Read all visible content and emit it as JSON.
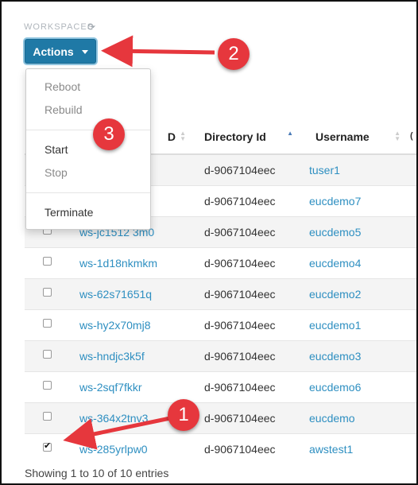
{
  "header": {
    "section_title": "WORKSPACES",
    "refresh_icon": "refresh-icon"
  },
  "actions": {
    "label": "Actions",
    "menu": [
      {
        "label": "Reboot",
        "enabled": false
      },
      {
        "label": "Rebuild",
        "enabled": false
      },
      {
        "label": "Start",
        "enabled": true
      },
      {
        "label": "Stop",
        "enabled": false
      },
      {
        "label": "Terminate",
        "enabled": true
      }
    ]
  },
  "table": {
    "columns": [
      "D",
      "Directory Id",
      "Username",
      "("
    ],
    "rows": [
      {
        "id": "",
        "directory": "d-9067104eec",
        "username": "tuser1",
        "checked": false
      },
      {
        "id": "",
        "directory": "d-9067104eec",
        "username": "eucdemo7",
        "checked": false
      },
      {
        "id": "ws-jc1512 3m0",
        "directory": "d-9067104eec",
        "username": "eucdemo5",
        "checked": false
      },
      {
        "id": "ws-1d18nkmkm",
        "directory": "d-9067104eec",
        "username": "eucdemo4",
        "checked": false
      },
      {
        "id": "ws-62s71651q",
        "directory": "d-9067104eec",
        "username": "eucdemo2",
        "checked": false
      },
      {
        "id": "ws-hy2x70mj8",
        "directory": "d-9067104eec",
        "username": "eucdemo1",
        "checked": false
      },
      {
        "id": "ws-hndjc3k5f",
        "directory": "d-9067104eec",
        "username": "eucdemo3",
        "checked": false
      },
      {
        "id": "ws-2sqf7fkkr",
        "directory": "d-9067104eec",
        "username": "eucdemo6",
        "checked": false
      },
      {
        "id": "ws-364x2tnv3",
        "directory": "d-9067104eec",
        "username": "eucdemo",
        "checked": false
      },
      {
        "id": "ws-285yrlpw0",
        "directory": "d-9067104eec",
        "username": "awstest1",
        "checked": true
      }
    ]
  },
  "footer": {
    "info": "Showing 1 to 10 of 10 entries"
  },
  "annotations": {
    "badge1": "1",
    "badge2": "2",
    "badge3": "3",
    "color": "#e6373d"
  }
}
